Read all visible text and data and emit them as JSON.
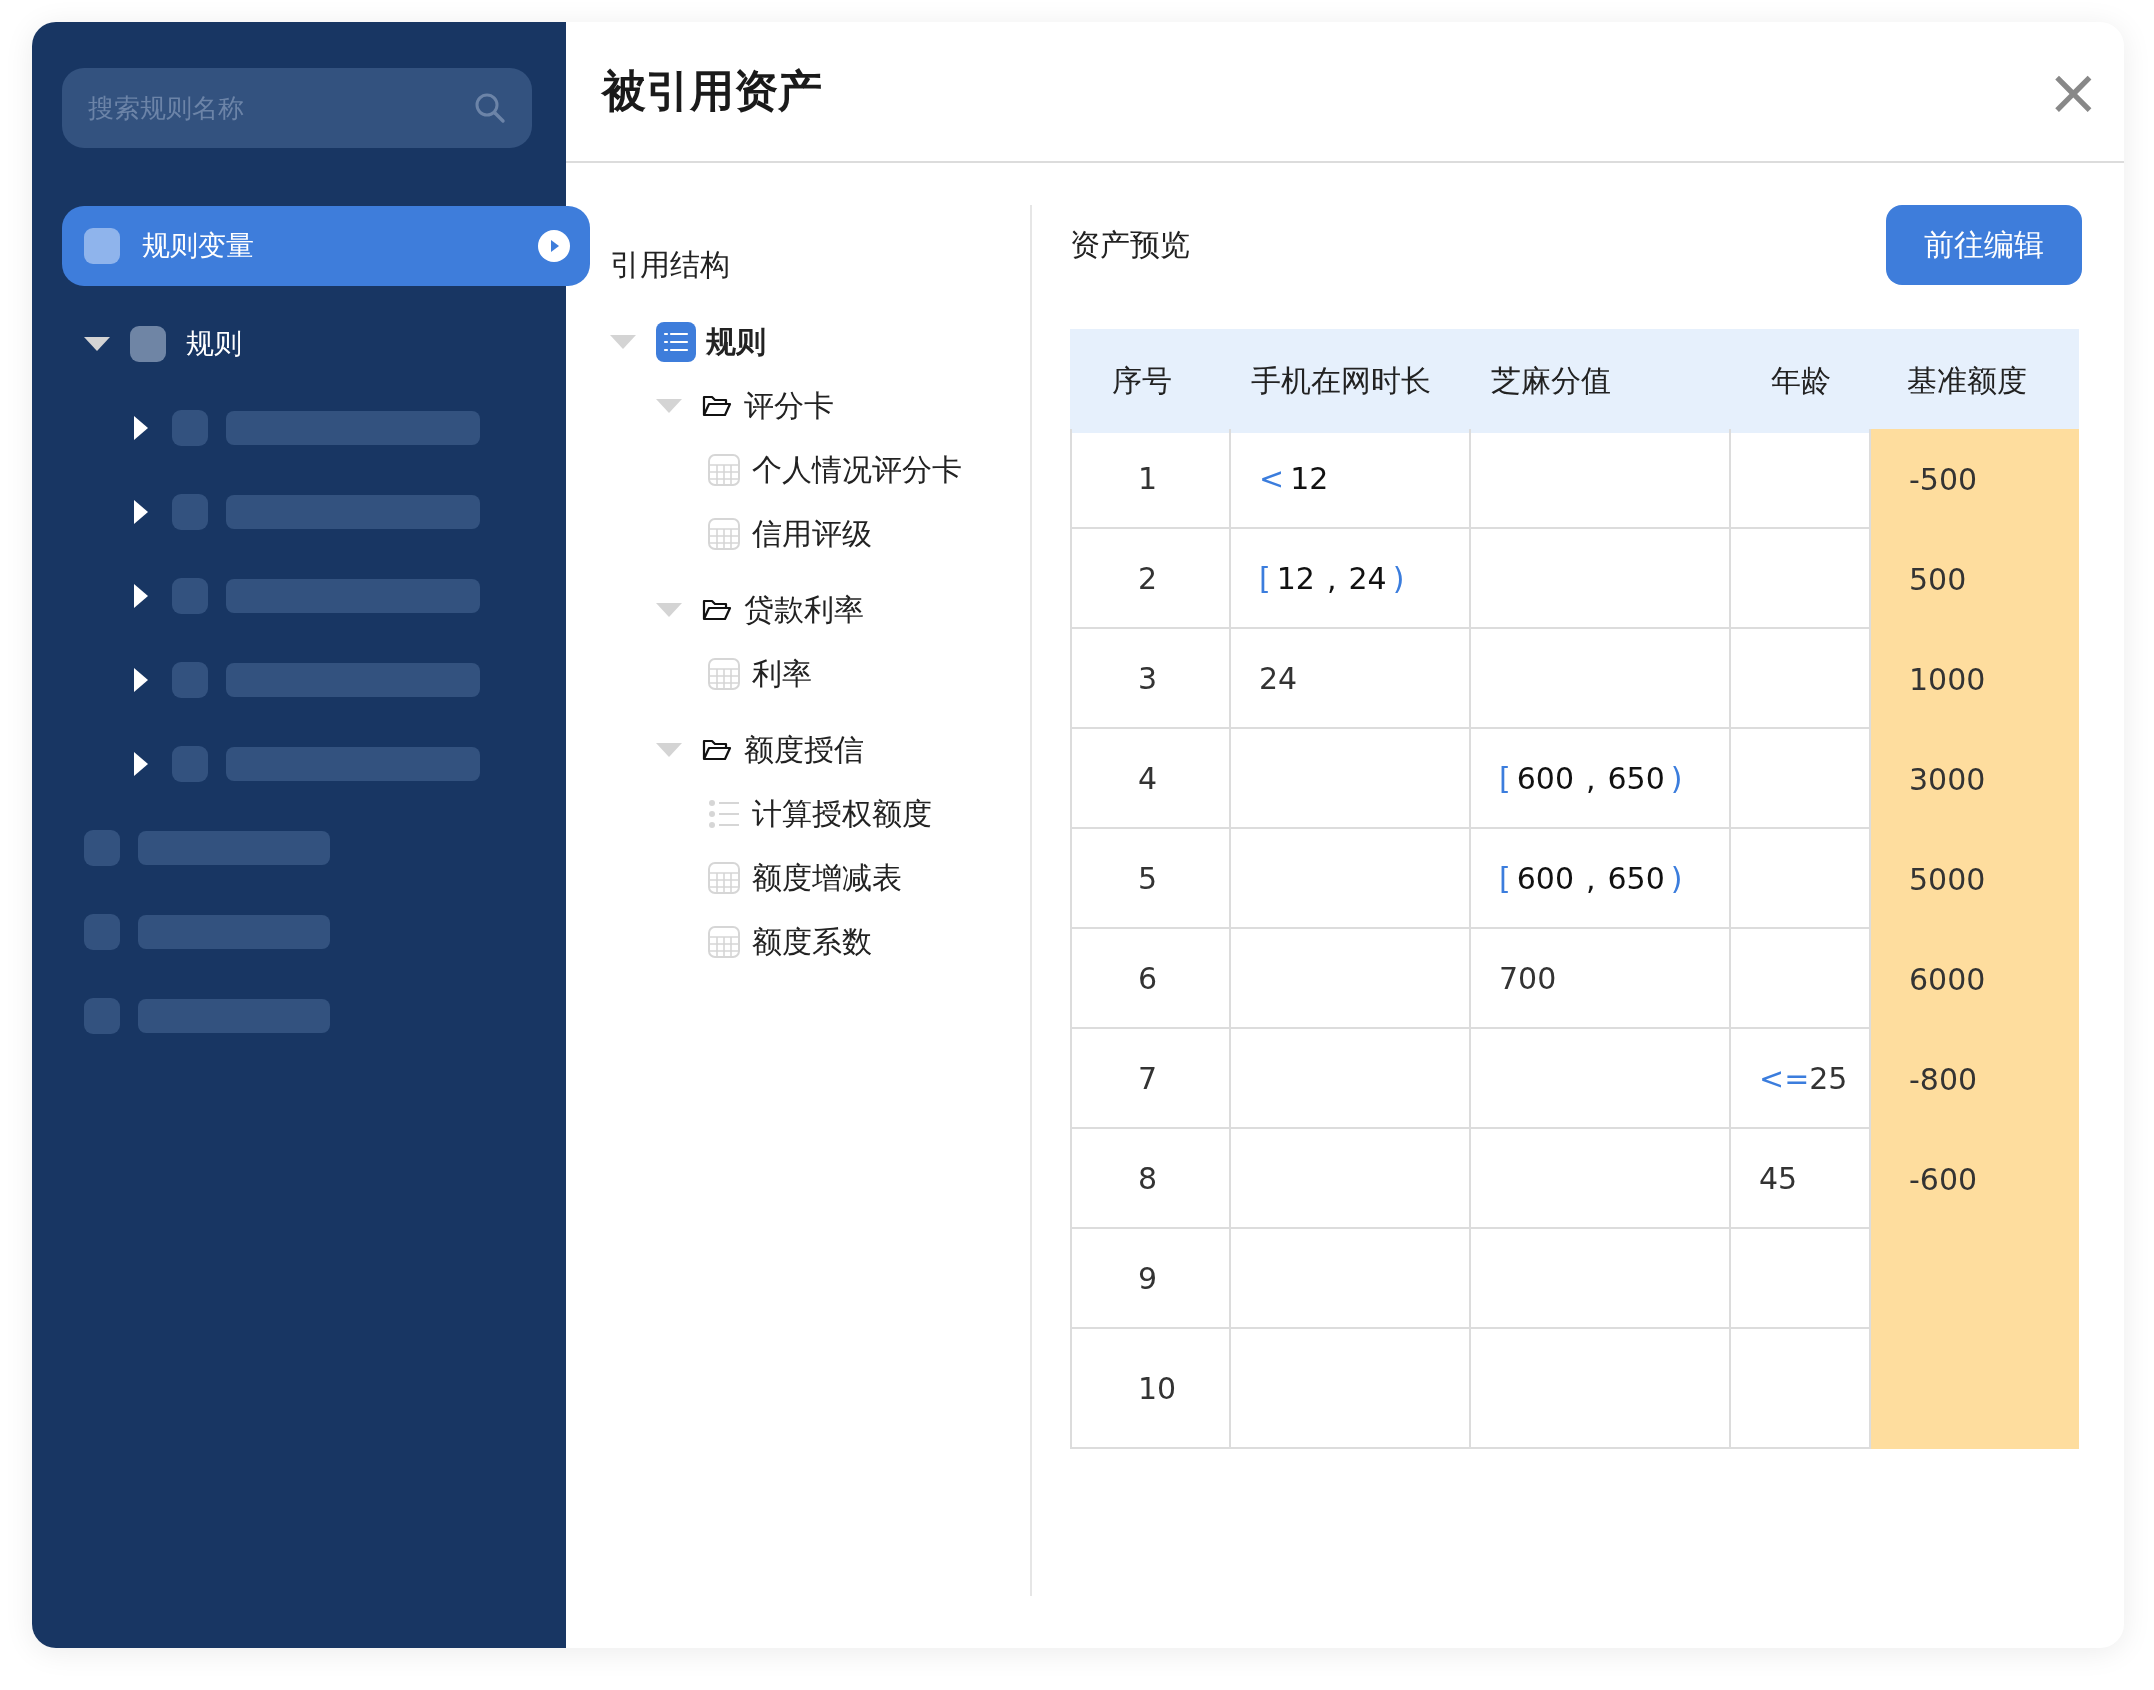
{
  "sidebar": {
    "search": {
      "placeholder": "搜索规则名称"
    },
    "items": [
      {
        "kind": "item",
        "label": "规则变量",
        "selected": true
      },
      {
        "kind": "group",
        "label": "规则",
        "selected": false,
        "expanded": true,
        "children": [
          {
            "expanded": false
          },
          {
            "expanded": false
          },
          {
            "expanded": false
          },
          {
            "expanded": false
          },
          {
            "expanded": false
          }
        ]
      },
      {
        "kind": "skeleton"
      },
      {
        "kind": "skeleton"
      },
      {
        "kind": "skeleton"
      }
    ]
  },
  "dialog": {
    "title": "被引用资产",
    "close": "×"
  },
  "structure": {
    "heading": "引用结构",
    "tree": {
      "label": "规则",
      "kind": "list",
      "expanded": true,
      "children": [
        {
          "label": "评分卡",
          "kind": "folder",
          "expanded": true,
          "children": [
            {
              "label": "个人情况评分卡",
              "kind": "table"
            },
            {
              "label": "信用评级",
              "kind": "table"
            }
          ]
        },
        {
          "label": "贷款利率",
          "kind": "folder",
          "expanded": true,
          "children": [
            {
              "label": "利率",
              "kind": "table"
            }
          ]
        },
        {
          "label": "额度授信",
          "kind": "folder",
          "expanded": true,
          "children": [
            {
              "label": "计算授权额度",
              "kind": "list"
            },
            {
              "label": "额度增减表",
              "kind": "table"
            },
            {
              "label": "额度系数",
              "kind": "table"
            }
          ]
        }
      ]
    }
  },
  "preview": {
    "heading": "资产预览",
    "edit_button": "前往编辑",
    "table": {
      "columns": [
        "序号",
        "手机在网时长",
        "芝麻分值",
        "年龄",
        "基准额度"
      ],
      "rows": [
        {
          "cells": [
            "1",
            [
              {
                "kind": "op",
                "text": "<"
              },
              {
                "kind": "num",
                "text": "12"
              }
            ],
            "",
            "",
            "-500"
          ]
        },
        {
          "cells": [
            "2",
            [
              {
                "kind": "op",
                "text": "["
              },
              {
                "kind": "num",
                "text": "12"
              },
              {
                "kind": "num",
                "text": ","
              },
              {
                "kind": "num",
                "text": "24"
              },
              {
                "kind": "op",
                "text": ")"
              }
            ],
            "",
            "",
            "500"
          ]
        },
        {
          "cells": [
            "3",
            "24",
            "",
            "",
            "1000"
          ]
        },
        {
          "cells": [
            "4",
            "",
            [
              {
                "kind": "op",
                "text": "["
              },
              {
                "kind": "num",
                "text": "600"
              },
              {
                "kind": "num",
                "text": ","
              },
              {
                "kind": "num",
                "text": "650"
              },
              {
                "kind": "op",
                "text": ")"
              }
            ],
            "",
            "3000"
          ]
        },
        {
          "cells": [
            "5",
            "",
            [
              {
                "kind": "op",
                "text": "["
              },
              {
                "kind": "num",
                "text": "600"
              },
              {
                "kind": "num",
                "text": ","
              },
              {
                "kind": "num",
                "text": "650"
              },
              {
                "kind": "op",
                "text": ")"
              }
            ],
            "",
            "5000"
          ]
        },
        {
          "cells": [
            "6",
            "",
            "700",
            "",
            "6000"
          ]
        },
        {
          "cells": [
            "7",
            "",
            "",
            [
              {
                "kind": "op",
                "text": "<="
              },
              {
                "kind": "plain",
                "text": "25"
              }
            ],
            "-800"
          ]
        },
        {
          "cells": [
            "8",
            "",
            "",
            "45",
            "-600"
          ]
        },
        {
          "cells": [
            "9",
            "",
            "",
            "",
            ""
          ]
        },
        {
          "cells": [
            "10",
            "",
            "",
            "",
            ""
          ]
        }
      ]
    }
  }
}
